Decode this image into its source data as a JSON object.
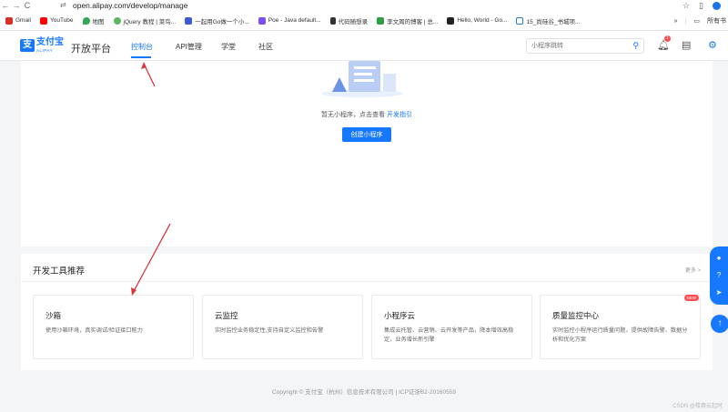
{
  "browser": {
    "back": "←",
    "forward": "→",
    "reload": "C",
    "url": "open.alipay.com/develop/manage",
    "bookmarks": [
      {
        "label": "Gmail",
        "color": "#d93025"
      },
      {
        "label": "YouTube",
        "color": "#ff0000"
      },
      {
        "label": "地图",
        "color": "#34a853"
      },
      {
        "label": "jQuery 教程 | 菜鸟...",
        "color": "#5cb85c"
      },
      {
        "label": "一起用Go做一个小...",
        "color": "#3b5bdb"
      },
      {
        "label": "Poe - Java default...",
        "color": "#7950f2"
      },
      {
        "label": "代码随想录",
        "color": "#333333"
      },
      {
        "label": "李文周的博客 | 总...",
        "color": "#2f9e44"
      },
      {
        "label": "Hello, World - Go...",
        "color": "#222222"
      },
      {
        "label": "15_尚硅谷_书城项...",
        "color": "#1c7ed6"
      }
    ],
    "more": "»",
    "all_bookmarks": "所有书"
  },
  "header": {
    "logo_cn": "支付宝",
    "logo_en": "ALIPAY",
    "platform": "开放平台",
    "nav": [
      "控制台",
      "API管理",
      "学堂",
      "社区"
    ],
    "search_placeholder": "小程序跳转",
    "notification_count": "1"
  },
  "main": {
    "empty_text": "暂无小程序，点击查看",
    "empty_link": "开发指引",
    "create_button": "创建小程序"
  },
  "tools": {
    "title": "开发工具推荐",
    "more": "更多 >",
    "new_badge": "NEW",
    "cards": [
      {
        "name": "沙箱",
        "desc": "使用沙箱环境，真实调试/验证接口能力"
      },
      {
        "name": "云监控",
        "desc": "实时监控业务稳定性,支持自定义监控和告警"
      },
      {
        "name": "小程序云",
        "desc": "集成云托管、云营销、云开发等产品，降本增效高稳定，业务增长新引擎"
      },
      {
        "name": "质量监控中心",
        "desc": "实时监控小程序运行质量问题，提供故障告警、数据分析和优化方案"
      }
    ]
  },
  "footer": "Copyright © 支付宝（杭州）信息技术有限公司 | ICP证浙B2-20160559",
  "watermark": "CSDN @楼蓑云起时",
  "accent": "#1677ff"
}
